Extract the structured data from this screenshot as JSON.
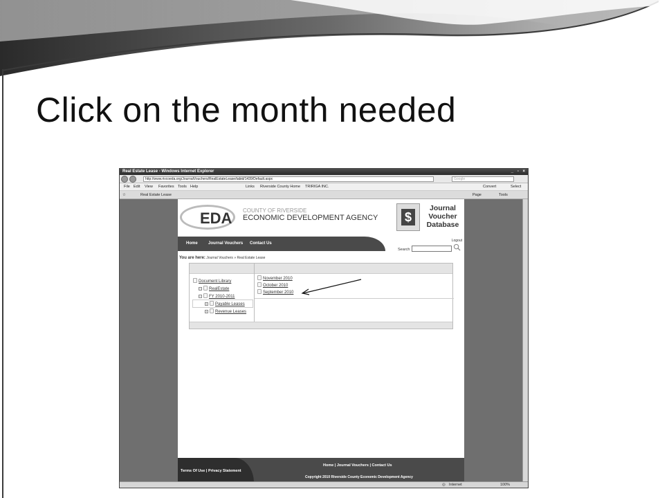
{
  "slide": {
    "title": "Click on the month needed"
  },
  "browser": {
    "window_title": "Real Estate Lease - Windows Internet Explorer",
    "window_buttons": "_ ▫ ×",
    "url": "http://www.rivcoeda.org/JournalVouchers/RealEstateLease/tabid/1439/Default.aspx",
    "search_placeholder": "Google",
    "menu": [
      "File",
      "Edit",
      "View",
      "Favorites",
      "Tools",
      "Help"
    ],
    "links_label": "Links",
    "links": [
      "Riverside County Home",
      "TRIRIGA INC."
    ],
    "convert_label": "Convert",
    "select_label": "Select",
    "tab_title": "Real Estate Lease",
    "toolbar_right": [
      "Page",
      "Tools"
    ],
    "status_zone": "Internet",
    "status_zoom": "100%"
  },
  "site": {
    "logo_text": "EDA",
    "county": "COUNTY OF RIVERSIDE",
    "agency": "ECONOMIC DEVELOPMENT AGENCY",
    "dollar": "$",
    "db_title": [
      "Journal",
      "Voucher",
      "Database"
    ],
    "logout": "Logout",
    "nav": [
      "Home",
      "Journal Vouchers",
      "Contact Us"
    ],
    "search_label": "Search",
    "breadcrumb_label": "You are here:",
    "breadcrumb_path": "Journal Vouchers » Real Estate Lease"
  },
  "tree": {
    "root": "Document Library",
    "realestate": "RealEstate",
    "fy": "FY 2010-2011",
    "payable": "Payable Leases",
    "revenue": "Revenue Leases"
  },
  "months": [
    "November 2010",
    "October 2010",
    "September 2010"
  ],
  "footer": {
    "left": "Terms Of Use  |  Privacy Statement",
    "links": "Home  |  Journal Vouchers  |  Contact Us",
    "copyright": "Copyright 2010 Riverside County Economic Development Agency"
  }
}
